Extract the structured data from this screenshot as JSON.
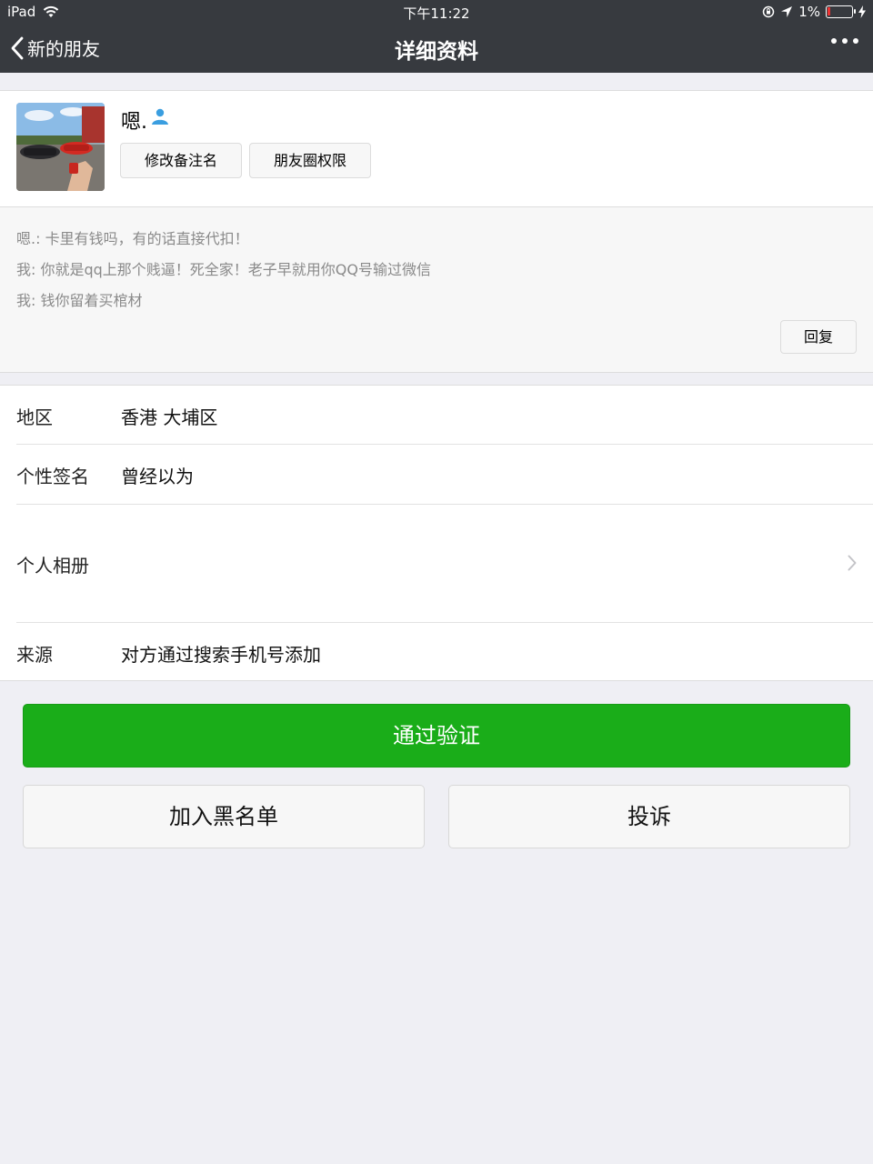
{
  "status_bar": {
    "device": "iPad",
    "time": "下午11:22",
    "battery": "1%",
    "battery_level": 0.01
  },
  "nav": {
    "back_label": "新的朋友",
    "title": "详细资料"
  },
  "profile": {
    "nickname": "嗯.",
    "remark_button": "修改备注名",
    "moments_button": "朋友圈权限"
  },
  "messages": [
    "嗯.: 卡里有钱吗，有的话直接代扣！",
    "我: 你就是qq上那个贱逼！死全家！老子早就用你QQ号输过微信",
    "我: 钱你留着买棺材"
  ],
  "reply_button": "回复",
  "info": {
    "region_label": "地区",
    "region_value": "香港 大埔区",
    "signature_label": "个性签名",
    "signature_value": "曾经以为",
    "album_label": "个人相册",
    "source_label": "来源",
    "source_value": "对方通过搜索手机号添加"
  },
  "actions": {
    "approve": "通过验证",
    "blacklist": "加入黑名单",
    "report": "投诉"
  },
  "colors": {
    "nav_bg": "#373a3f",
    "primary_green": "#1aad19",
    "page_bg": "#efeff4"
  }
}
